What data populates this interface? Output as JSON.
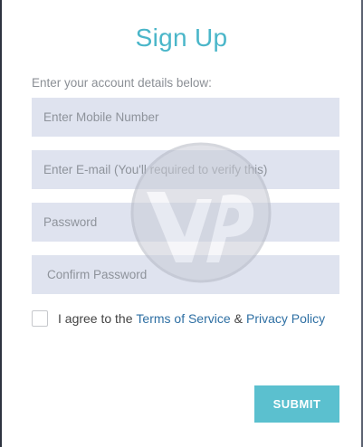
{
  "title": "Sign Up",
  "instructions": "Enter your account details below:",
  "fields": {
    "mobile_placeholder": "Enter Mobile Number",
    "email_placeholder": "Enter E-mail (You'll required to verify this)",
    "password_placeholder": "Password",
    "confirm_password_placeholder": "Confirm Password"
  },
  "agreement": {
    "prefix": "I agree to the",
    "terms_link": "Terms of Service",
    "separator": "&",
    "privacy_link": "Privacy Policy"
  },
  "submit_label": "SUBMIT",
  "colors": {
    "accent": "#4ab6c9",
    "button": "#5bc0cf",
    "input_bg": "#dfe3ef",
    "link": "#2e6fa3"
  },
  "watermark_icon": "vp-logo-watermark"
}
